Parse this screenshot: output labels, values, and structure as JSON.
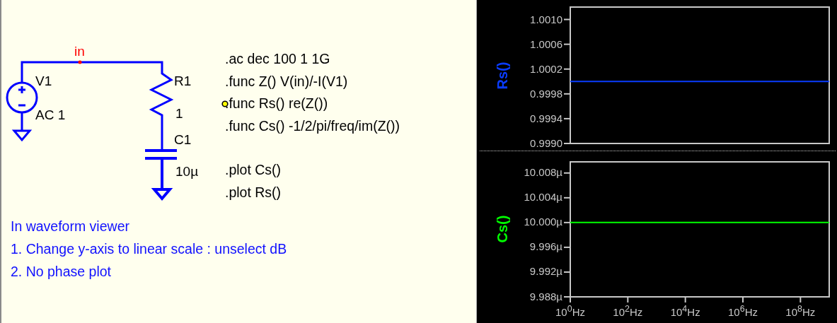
{
  "schematic": {
    "net_label": "in",
    "components": [
      {
        "kind": "voltage_source",
        "name": "V1",
        "value": "AC 1"
      },
      {
        "kind": "resistor",
        "name": "R1",
        "value": "1"
      },
      {
        "kind": "capacitor",
        "name": "C1",
        "value": "10µ"
      }
    ]
  },
  "directive_groups": [
    [
      {
        "text": ".ac dec 100 1 1G",
        "anchored": false
      },
      {
        "text": ".func Z() V(in)/-I(V1)",
        "anchored": false
      },
      {
        "text": ".func Rs() re(Z())",
        "anchored": true
      },
      {
        "text": ".func Cs() -1/2/pi/freq/im(Z())",
        "anchored": false
      }
    ],
    [
      {
        "text": ".plot Cs()",
        "anchored": false
      },
      {
        "text": ".plot Rs()",
        "anchored": false
      }
    ]
  ],
  "notes": [
    "In waveform viewer",
    "1. Change y-axis to linear scale : unselect dB",
    "2. No phase plot"
  ],
  "plots": [
    {
      "chart_data": {
        "type": "line",
        "categories": [
          null,
          null,
          null,
          null,
          null,
          null,
          null,
          null,
          null,
          null
        ],
        "ylim": [
          0.999,
          1.0012
        ],
        "series": [
          {
            "name": "Rs()",
            "color": "#0a3cff",
            "values": [
              1,
              1,
              1,
              1,
              1,
              1,
              1,
              1,
              1,
              1
            ]
          }
        ],
        "yticks": [
          {
            "value": 0.999,
            "label": "0.9990"
          },
          {
            "value": 0.9994,
            "label": "0.9994"
          },
          {
            "value": 0.9998,
            "label": "0.9998"
          },
          {
            "value": 1.0002,
            "label": "1.0002"
          },
          {
            "value": 1.0006,
            "label": "1.0006"
          },
          {
            "value": 1.001,
            "label": "1.0010"
          }
        ]
      }
    },
    {
      "chart_data": {
        "type": "line",
        "categories": [
          "10$^{0}$Hz",
          null,
          "10$^{2}$Hz",
          null,
          "10$^{4}$Hz",
          null,
          "10$^{6}$Hz",
          null,
          "10$^{8}$Hz",
          null
        ],
        "ylim": [
          9.988,
          10.0098
        ],
        "series": [
          {
            "name": "Cs()",
            "color": "#00ff00",
            "values": [
              10,
              10,
              10,
              10,
              10,
              10,
              10,
              10,
              10,
              10
            ]
          }
        ],
        "yticks": [
          {
            "value": 9.988,
            "label": "9.988µ"
          },
          {
            "value": 9.992,
            "label": "9.992µ"
          },
          {
            "value": 9.996,
            "label": "9.996µ"
          },
          {
            "value": 10,
            "label": "10.000µ"
          },
          {
            "value": 10.004,
            "label": "10.004µ"
          },
          {
            "value": 10.008,
            "label": "10.008µ"
          }
        ]
      }
    }
  ]
}
